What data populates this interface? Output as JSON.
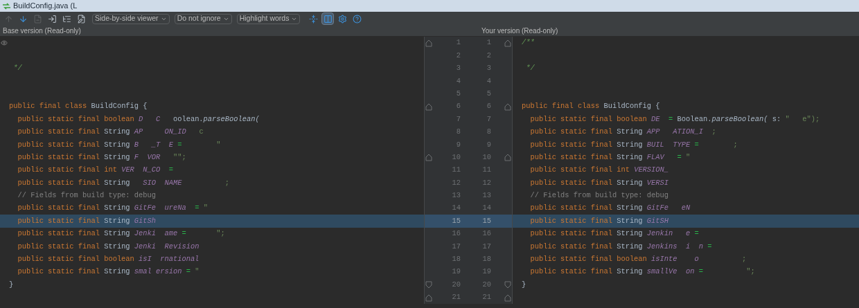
{
  "window": {
    "title": "BuildConfig.java (L"
  },
  "toolbar": {
    "buttons": [
      {
        "kind": "up",
        "disabled": true,
        "selected": false
      },
      {
        "kind": "down",
        "disabled": false,
        "selected": false
      },
      {
        "kind": "revert",
        "disabled": true,
        "selected": false
      },
      {
        "kind": "open",
        "disabled": false,
        "selected": false
      },
      {
        "kind": "tree",
        "disabled": false,
        "selected": false
      },
      {
        "kind": "edit",
        "disabled": false,
        "selected": false
      }
    ],
    "dropdowns": [
      "Side-by-side viewer",
      "Do not ignore",
      "Highlight words"
    ],
    "tools": [
      {
        "kind": "collapse",
        "selected": false
      },
      {
        "kind": "sync",
        "selected": true
      },
      {
        "kind": "settings",
        "selected": false
      },
      {
        "kind": "help",
        "selected": false
      }
    ]
  },
  "panes": {
    "left_title": "Base version (Read-only)",
    "right_title": "Your version (Read-only)"
  },
  "rows": [
    {
      "left_number": "1",
      "right_number": "1",
      "selected": false,
      "fold_start": true,
      "fold_end": false,
      "left": [],
      "right": [
        {
          "text": "/**",
          "kind": "doc"
        }
      ]
    },
    {
      "left_number": "2",
      "right_number": "2",
      "selected": false,
      "fold_start": false,
      "fold_end": false,
      "left": [],
      "right": []
    },
    {
      "left_number": "3",
      "right_number": "3",
      "selected": false,
      "fold_start": false,
      "fold_end": false,
      "left": [
        {
          "text": " */",
          "kind": "doc"
        }
      ],
      "right": [
        {
          "text": " */",
          "kind": "doc"
        }
      ]
    },
    {
      "left_number": "4",
      "right_number": "4",
      "selected": false,
      "fold_start": false,
      "fold_end": false,
      "left": [],
      "right": []
    },
    {
      "left_number": "5",
      "right_number": "5",
      "selected": false,
      "fold_start": false,
      "fold_end": false,
      "left": [],
      "right": []
    },
    {
      "left_number": "6",
      "right_number": "6",
      "selected": false,
      "fold_start": true,
      "fold_end": false,
      "left": [
        {
          "text": "public final class ",
          "kind": "keyword"
        },
        {
          "text": "BuildConfig {",
          "kind": "plain"
        }
      ],
      "right": [
        {
          "text": "public final class ",
          "kind": "keyword"
        },
        {
          "text": "BuildConfig {",
          "kind": "plain"
        }
      ]
    },
    {
      "left_number": "7",
      "right_number": "7",
      "selected": false,
      "fold_start": false,
      "fold_end": false,
      "left": [
        {
          "text": "  public static final boolean ",
          "kind": "keyword"
        },
        {
          "text": "D   C   ",
          "kind": "field"
        },
        {
          "text": "oolean.",
          "kind": "plain"
        },
        {
          "text": "parseBoolean(",
          "kind": "method"
        }
      ],
      "right": [
        {
          "text": "  public static final boolean ",
          "kind": "keyword"
        },
        {
          "text": "DE  ",
          "kind": "field"
        },
        {
          "text": "= ",
          "kind": "op"
        },
        {
          "text": "Boolean.",
          "kind": "plain"
        },
        {
          "text": "parseBoolean(",
          "kind": "method"
        },
        {
          "text": " s: ",
          "kind": "plain"
        },
        {
          "text": "\"   e\");",
          "kind": "string"
        }
      ]
    },
    {
      "left_number": "8",
      "right_number": "8",
      "selected": false,
      "fold_start": false,
      "fold_end": false,
      "left": [
        {
          "text": "  public static final ",
          "kind": "keyword"
        },
        {
          "text": "String ",
          "kind": "plain"
        },
        {
          "text": "AP     ON_ID   ",
          "kind": "field"
        },
        {
          "text": "c",
          "kind": "string"
        }
      ],
      "right": [
        {
          "text": "  public static final ",
          "kind": "keyword"
        },
        {
          "text": "String ",
          "kind": "plain"
        },
        {
          "text": "APP   ATION_I  ",
          "kind": "field"
        },
        {
          "text": ";",
          "kind": "string"
        }
      ]
    },
    {
      "left_number": "9",
      "right_number": "9",
      "selected": false,
      "fold_start": false,
      "fold_end": false,
      "left": [
        {
          "text": "  public static final ",
          "kind": "keyword"
        },
        {
          "text": "String ",
          "kind": "plain"
        },
        {
          "text": "B   _T  E ",
          "kind": "field"
        },
        {
          "text": "=        ",
          "kind": "op"
        },
        {
          "text": "\"",
          "kind": "string"
        }
      ],
      "right": [
        {
          "text": "  public static final ",
          "kind": "keyword"
        },
        {
          "text": "String ",
          "kind": "plain"
        },
        {
          "text": "BUIL  TYPE ",
          "kind": "field"
        },
        {
          "text": "=        ",
          "kind": "op"
        },
        {
          "text": ";",
          "kind": "string"
        }
      ]
    },
    {
      "left_number": "10",
      "right_number": "10",
      "selected": false,
      "fold_start": true,
      "fold_end": false,
      "left": [
        {
          "text": "  public static final ",
          "kind": "keyword"
        },
        {
          "text": "String ",
          "kind": "plain"
        },
        {
          "text": "F  VOR   ",
          "kind": "field"
        },
        {
          "text": "\"\";",
          "kind": "string"
        }
      ],
      "right": [
        {
          "text": "  public static final ",
          "kind": "keyword"
        },
        {
          "text": "String ",
          "kind": "plain"
        },
        {
          "text": "FLAV   ",
          "kind": "field"
        },
        {
          "text": "= ",
          "kind": "op"
        },
        {
          "text": "\"",
          "kind": "string"
        }
      ]
    },
    {
      "left_number": "11",
      "right_number": "11",
      "selected": false,
      "fold_start": false,
      "fold_end": false,
      "left": [
        {
          "text": "  public static final ",
          "kind": "keyword"
        },
        {
          "text": "int ",
          "kind": "keyword"
        },
        {
          "text": "VER  N_CO  ",
          "kind": "field"
        },
        {
          "text": "=",
          "kind": "op"
        }
      ],
      "right": [
        {
          "text": "  public static final ",
          "kind": "keyword"
        },
        {
          "text": "int ",
          "kind": "keyword"
        },
        {
          "text": "VERSION_",
          "kind": "field"
        }
      ]
    },
    {
      "left_number": "12",
      "right_number": "12",
      "selected": false,
      "fold_start": false,
      "fold_end": false,
      "left": [
        {
          "text": "  public static final ",
          "kind": "keyword"
        },
        {
          "text": "String ",
          "kind": "plain"
        },
        {
          "text": "  SIO  NAME          ",
          "kind": "field"
        },
        {
          "text": ";",
          "kind": "string"
        }
      ],
      "right": [
        {
          "text": "  public static final ",
          "kind": "keyword"
        },
        {
          "text": "String ",
          "kind": "plain"
        },
        {
          "text": "VERSI",
          "kind": "field"
        }
      ]
    },
    {
      "left_number": "13",
      "right_number": "13",
      "selected": false,
      "fold_start": false,
      "fold_end": false,
      "left": [
        {
          "text": "  // Fields from build type: debug",
          "kind": "comment"
        }
      ],
      "right": [
        {
          "text": "  // Fields from build type: debug",
          "kind": "comment"
        }
      ]
    },
    {
      "left_number": "14",
      "right_number": "14",
      "selected": false,
      "fold_start": false,
      "fold_end": false,
      "left": [
        {
          "text": "  public static final ",
          "kind": "keyword"
        },
        {
          "text": "String ",
          "kind": "plain"
        },
        {
          "text": "GitFe  ureNa  ",
          "kind": "field"
        },
        {
          "text": "= ",
          "kind": "op"
        },
        {
          "text": "\"",
          "kind": "string"
        }
      ],
      "right": [
        {
          "text": "  public static final ",
          "kind": "keyword"
        },
        {
          "text": "String ",
          "kind": "plain"
        },
        {
          "text": "GitFe   eN",
          "kind": "field"
        }
      ]
    },
    {
      "left_number": "15",
      "right_number": "15",
      "selected": true,
      "fold_start": false,
      "fold_end": false,
      "left": [
        {
          "text": "  public static final ",
          "kind": "keyword"
        },
        {
          "text": "String ",
          "kind": "plain"
        },
        {
          "text": "GitSh",
          "kind": "field"
        }
      ],
      "right": [
        {
          "text": "  public static final ",
          "kind": "keyword"
        },
        {
          "text": "String ",
          "kind": "plain"
        },
        {
          "text": "GitSH",
          "kind": "field"
        }
      ]
    },
    {
      "left_number": "16",
      "right_number": "16",
      "selected": false,
      "fold_start": false,
      "fold_end": false,
      "left": [
        {
          "text": "  public static final ",
          "kind": "keyword"
        },
        {
          "text": "String ",
          "kind": "plain"
        },
        {
          "text": "Jenki  ame ",
          "kind": "field"
        },
        {
          "text": "=       ",
          "kind": "op"
        },
        {
          "text": "\";",
          "kind": "string"
        }
      ],
      "right": [
        {
          "text": "  public static final ",
          "kind": "keyword"
        },
        {
          "text": "String ",
          "kind": "plain"
        },
        {
          "text": "Jenkin   e ",
          "kind": "field"
        },
        {
          "text": "=",
          "kind": "op"
        }
      ]
    },
    {
      "left_number": "17",
      "right_number": "17",
      "selected": false,
      "fold_start": false,
      "fold_end": false,
      "left": [
        {
          "text": "  public static final ",
          "kind": "keyword"
        },
        {
          "text": "String ",
          "kind": "plain"
        },
        {
          "text": "Jenki  Revision",
          "kind": "field"
        }
      ],
      "right": [
        {
          "text": "  public static final ",
          "kind": "keyword"
        },
        {
          "text": "String ",
          "kind": "plain"
        },
        {
          "text": "Jenkins  i  n ",
          "kind": "field"
        },
        {
          "text": "=",
          "kind": "op"
        }
      ]
    },
    {
      "left_number": "18",
      "right_number": "18",
      "selected": false,
      "fold_start": false,
      "fold_end": false,
      "left": [
        {
          "text": "  public static final boolean ",
          "kind": "keyword"
        },
        {
          "text": "isI  rnational",
          "kind": "field"
        }
      ],
      "right": [
        {
          "text": "  public static final boolean ",
          "kind": "keyword"
        },
        {
          "text": "isInte    o",
          "kind": "field"
        },
        {
          "text": "          ;",
          "kind": "string"
        }
      ]
    },
    {
      "left_number": "19",
      "right_number": "19",
      "selected": false,
      "fold_start": false,
      "fold_end": false,
      "left": [
        {
          "text": "  public static final ",
          "kind": "keyword"
        },
        {
          "text": "String ",
          "kind": "plain"
        },
        {
          "text": "smal ersion ",
          "kind": "field"
        },
        {
          "text": "= ",
          "kind": "op"
        },
        {
          "text": "\"",
          "kind": "string"
        }
      ],
      "right": [
        {
          "text": "  public static final ",
          "kind": "keyword"
        },
        {
          "text": "String ",
          "kind": "plain"
        },
        {
          "text": "smallVe  on ",
          "kind": "field"
        },
        {
          "text": "=",
          "kind": "op"
        },
        {
          "text": "          \";",
          "kind": "string"
        }
      ]
    },
    {
      "left_number": "20",
      "right_number": "20",
      "selected": false,
      "fold_start": false,
      "fold_end": true,
      "left": [
        {
          "text": "}",
          "kind": "plain"
        }
      ],
      "right": [
        {
          "text": "}",
          "kind": "plain"
        }
      ]
    },
    {
      "left_number": "21",
      "right_number": "21",
      "selected": false,
      "fold_start": true,
      "fold_end": false,
      "left": [],
      "right": []
    }
  ]
}
